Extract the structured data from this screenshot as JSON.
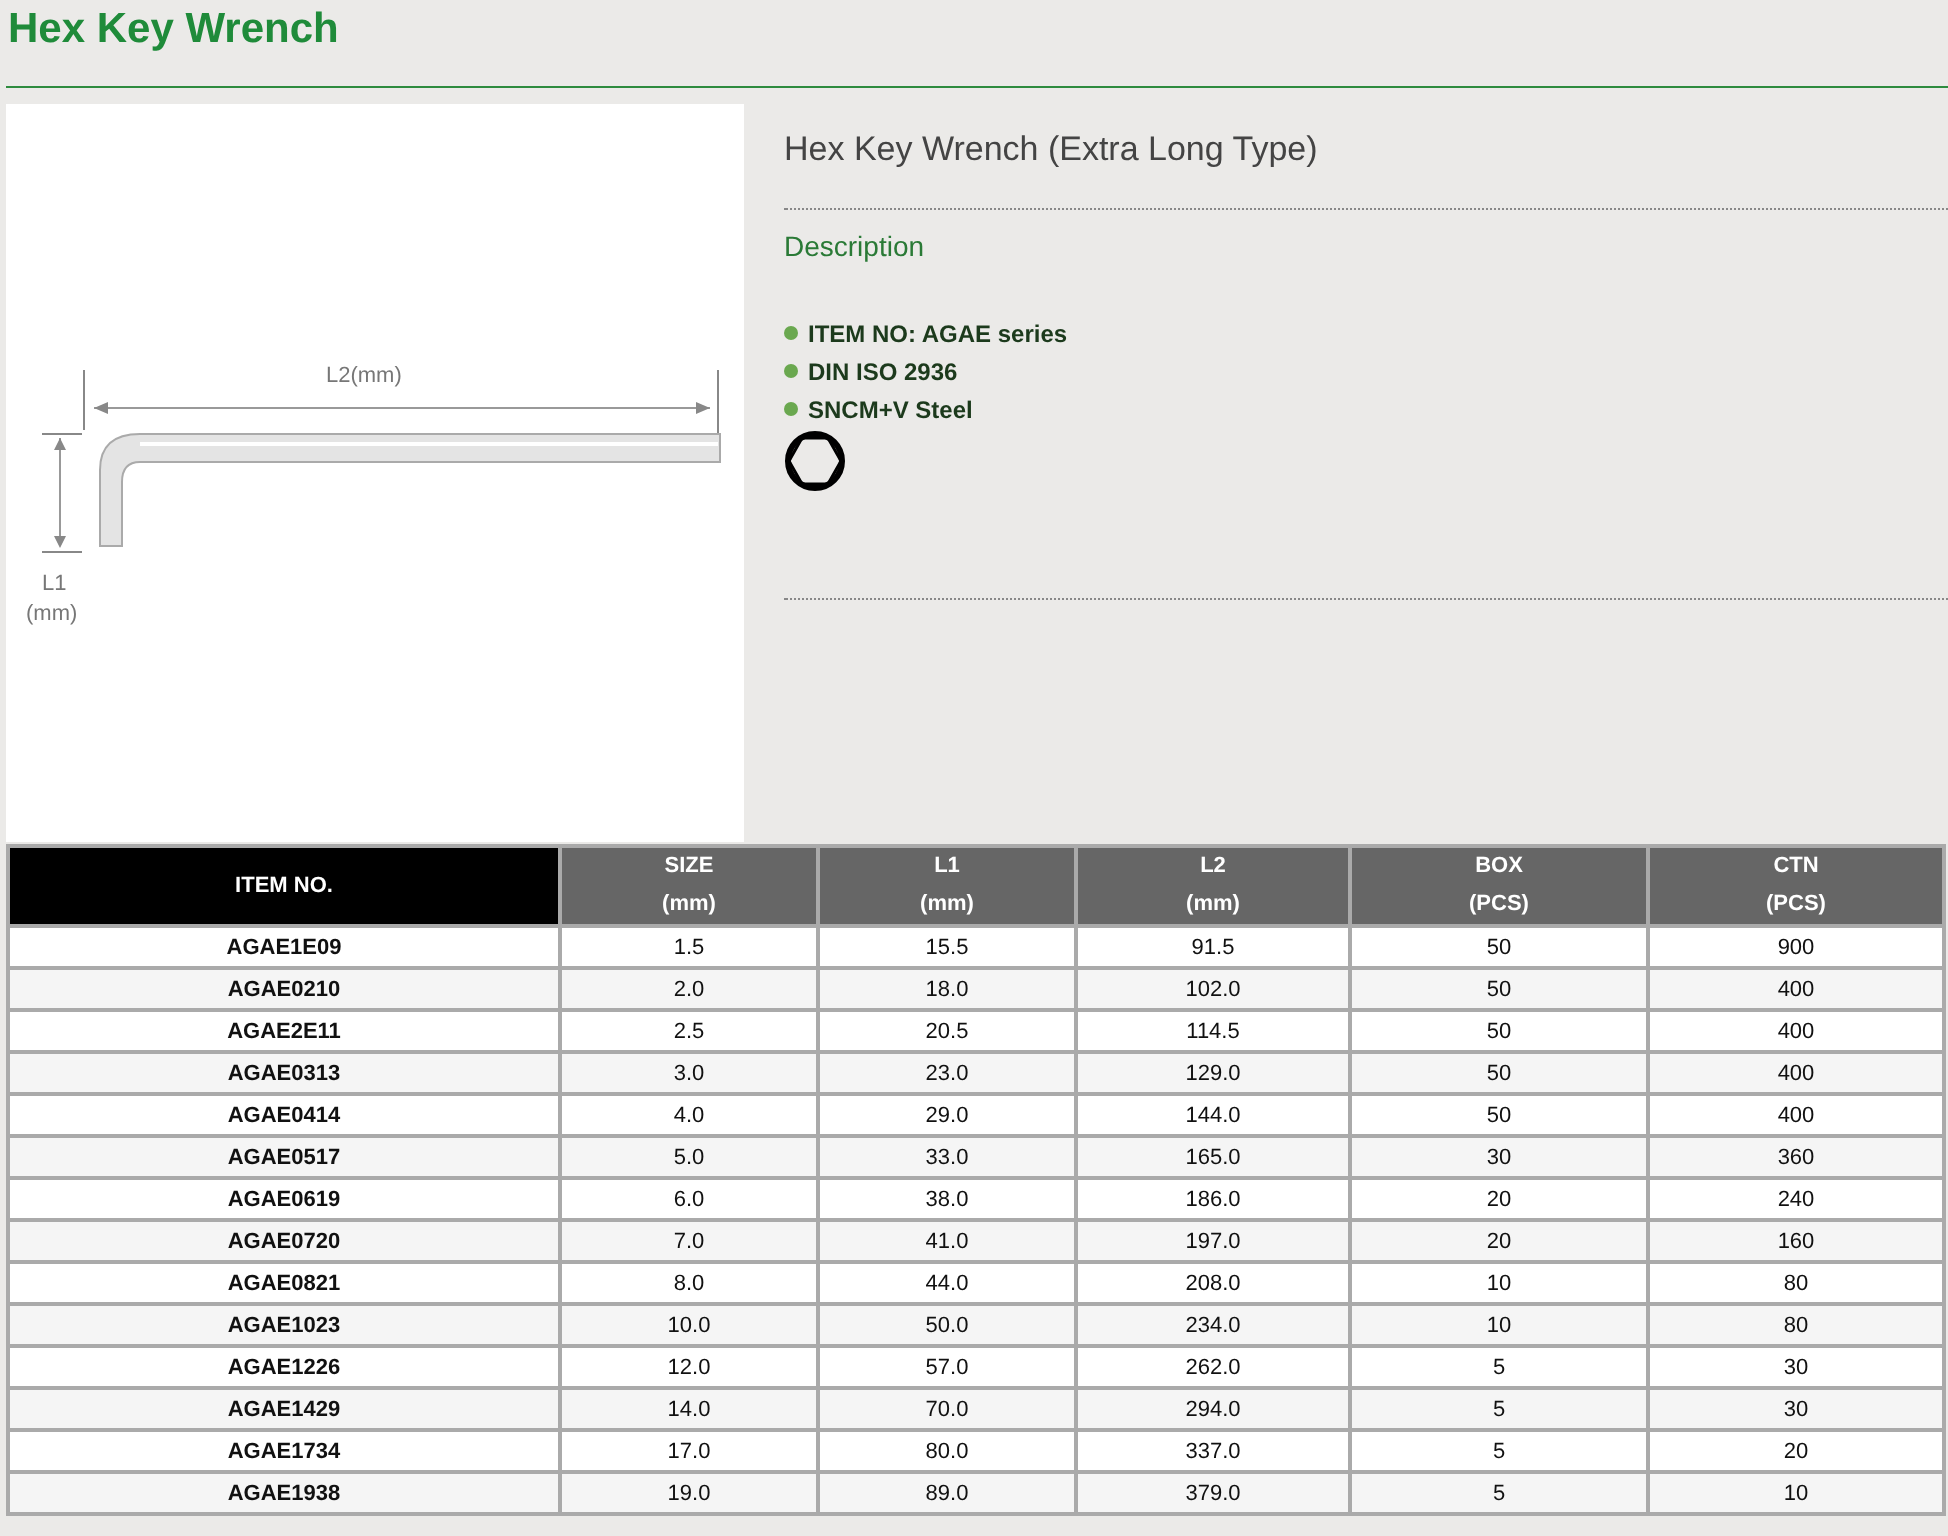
{
  "page_title": "Hex Key Wrench",
  "diagram": {
    "l2_label": "L2(mm)",
    "l1_label": "L1",
    "l1_unit": "(mm)"
  },
  "product": {
    "name": "Hex Key Wrench (Extra Long Type)",
    "section": "Description",
    "features": [
      {
        "label": "ITEM NO: AGAE series"
      },
      {
        "label": "DIN ISO 2936"
      },
      {
        "label": "SNCM+V Steel"
      }
    ]
  },
  "table": {
    "columns": [
      {
        "label": "ITEM NO.",
        "kind": "key"
      },
      {
        "label": "SIZE",
        "unit": "(mm)",
        "kind": "value"
      },
      {
        "label": "L1",
        "unit": "(mm)",
        "kind": "value"
      },
      {
        "label": "L2",
        "unit": "(mm)",
        "kind": "value"
      },
      {
        "label": "BOX",
        "unit": "(PCS)",
        "kind": "value"
      },
      {
        "label": "CTN",
        "unit": "(PCS)",
        "kind": "value"
      }
    ],
    "rows": [
      [
        "AGAE1E09",
        "1.5",
        "15.5",
        "91.5",
        "50",
        "900"
      ],
      [
        "AGAE0210",
        "2.0",
        "18.0",
        "102.0",
        "50",
        "400"
      ],
      [
        "AGAE2E11",
        "2.5",
        "20.5",
        "114.5",
        "50",
        "400"
      ],
      [
        "AGAE0313",
        "3.0",
        "23.0",
        "129.0",
        "50",
        "400"
      ],
      [
        "AGAE0414",
        "4.0",
        "29.0",
        "144.0",
        "50",
        "400"
      ],
      [
        "AGAE0517",
        "5.0",
        "33.0",
        "165.0",
        "30",
        "360"
      ],
      [
        "AGAE0619",
        "6.0",
        "38.0",
        "186.0",
        "20",
        "240"
      ],
      [
        "AGAE0720",
        "7.0",
        "41.0",
        "197.0",
        "20",
        "160"
      ],
      [
        "AGAE0821",
        "8.0",
        "44.0",
        "208.0",
        "10",
        "80"
      ],
      [
        "AGAE1023",
        "10.0",
        "50.0",
        "234.0",
        "10",
        "80"
      ],
      [
        "AGAE1226",
        "12.0",
        "57.0",
        "262.0",
        "5",
        "30"
      ],
      [
        "AGAE1429",
        "14.0",
        "70.0",
        "294.0",
        "5",
        "30"
      ],
      [
        "AGAE1734",
        "17.0",
        "80.0",
        "337.0",
        "5",
        "20"
      ],
      [
        "AGAE1938",
        "19.0",
        "89.0",
        "379.0",
        "5",
        "10"
      ]
    ]
  }
}
